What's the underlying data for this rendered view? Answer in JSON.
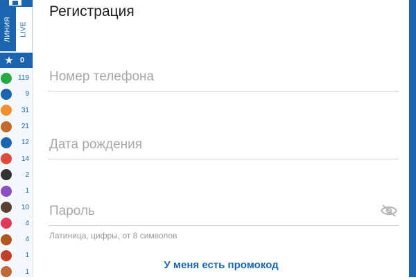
{
  "sidebar": {
    "tabs": [
      {
        "label": "ЛИНИЯ"
      },
      {
        "label": "LIVE"
      }
    ],
    "favorites": {
      "icon": "star-icon",
      "count": "0"
    },
    "sports": [
      {
        "icon": "soccer-ball-icon",
        "count": "119",
        "color": "#2aa845"
      },
      {
        "icon": "tennis-ball-icon",
        "count": "9",
        "color": "#1b64b0"
      },
      {
        "icon": "basketball-icon",
        "count": "31",
        "color": "#f0902a"
      },
      {
        "icon": "volleyball-icon",
        "count": "21",
        "color": "#c46a2d"
      },
      {
        "icon": "hockey-puck-icon",
        "count": "12",
        "color": "#1b64b0"
      },
      {
        "icon": "table-tennis-icon",
        "count": "14",
        "color": "#e04a3a"
      },
      {
        "icon": "billiards-ball-icon",
        "count": "2",
        "color": "#333333"
      },
      {
        "icon": "figure-skating-icon",
        "count": "1",
        "color": "#8a4fc0"
      },
      {
        "icon": "athletics-icon",
        "count": "10",
        "color": "#5a4030"
      },
      {
        "icon": "gamepad-icon",
        "count": "4",
        "color": "#e03a5a"
      },
      {
        "icon": "american-football-icon",
        "count": "4",
        "color": "#b0561e"
      },
      {
        "icon": "rugby-ball-icon",
        "count": "1",
        "color": "#c0402a"
      },
      {
        "icon": "handball-icon",
        "count": "1",
        "color": "#c06a3a"
      }
    ]
  },
  "main": {
    "title": "Регистрация",
    "phone_placeholder": "Номер телефона",
    "birth_placeholder": "Дата рождения",
    "password_placeholder": "Пароль",
    "password_hint": "Латиница, цифры, от 8 символов",
    "promo_link": "У меня есть промокод",
    "password_toggle_icon": "eye-off-icon"
  },
  "colors": {
    "brand": "#1b64b0",
    "placeholder": "#a8a8a8",
    "underline": "#cfcfcf"
  }
}
